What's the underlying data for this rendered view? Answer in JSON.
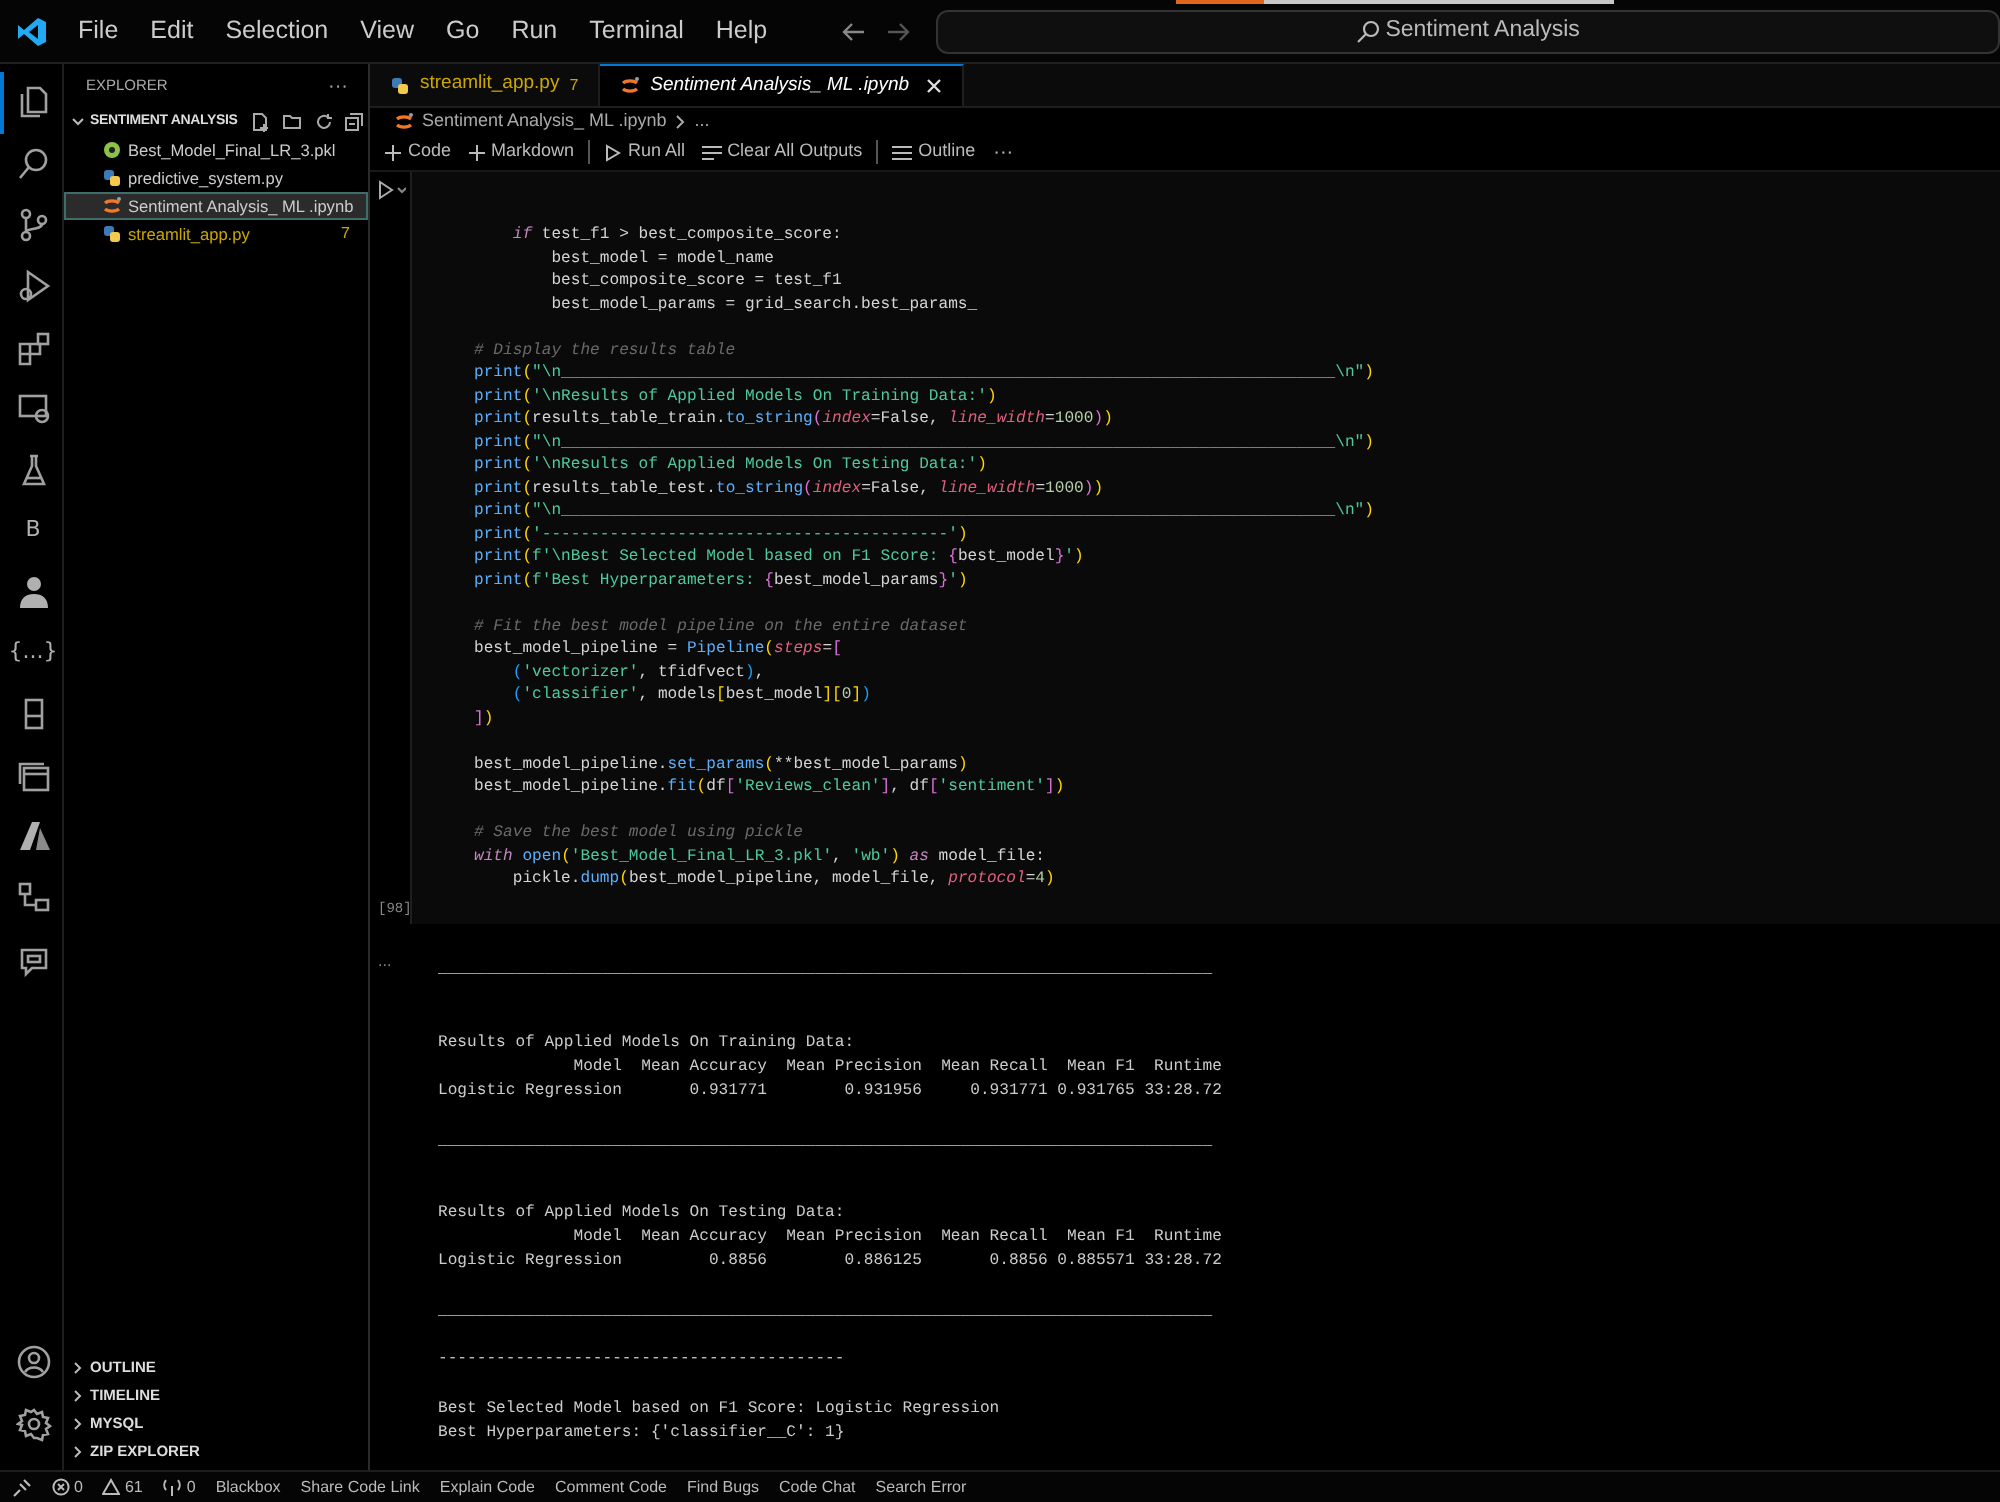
{
  "title_bar": {
    "menu": [
      "File",
      "Edit",
      "Selection",
      "View",
      "Go",
      "Run",
      "Terminal",
      "Help"
    ],
    "search": "Sentiment Analysis",
    "progress": {
      "level": 0.2
    }
  },
  "activity_bar": {
    "top": [
      {
        "kind": "files",
        "selected": true
      },
      {
        "kind": "search",
        "selected": false
      },
      {
        "kind": "source-control",
        "selected": false
      },
      {
        "kind": "run-debug",
        "selected": false
      },
      {
        "kind": "extensions",
        "selected": false
      },
      {
        "kind": "remote",
        "selected": false
      },
      {
        "kind": "flask",
        "selected": false
      },
      {
        "kind": "glyph",
        "text": "B",
        "selected": false
      },
      {
        "kind": "person",
        "selected": false
      },
      {
        "kind": "glyph",
        "text": "{...}",
        "selected": false
      },
      {
        "kind": "book",
        "selected": false
      },
      {
        "kind": "windows",
        "selected": false
      },
      {
        "kind": "azure",
        "selected": false
      },
      {
        "kind": "diagram",
        "selected": false
      },
      {
        "kind": "chat",
        "selected": false
      }
    ],
    "bottom": [
      {
        "kind": "account"
      },
      {
        "kind": "gear"
      }
    ]
  },
  "sidebar": {
    "title": "EXPLORER",
    "more": "···",
    "folder": {
      "label": "SENTIMENT ANALYSIS",
      "expanded": true
    },
    "files": [
      {
        "name": "Best_Model_Final_LR_3.pkl",
        "kind": "pkl",
        "selected": false,
        "warning": false
      },
      {
        "name": "predictive_system.py",
        "kind": "python",
        "selected": false,
        "warning": false
      },
      {
        "name": "Sentiment Analysis_ ML .ipynb",
        "kind": "notebook",
        "selected": true,
        "warning": false
      },
      {
        "name": "streamlit_app.py",
        "kind": "python",
        "selected": false,
        "warning": true,
        "badge": "7"
      }
    ],
    "sections": [
      {
        "label": "OUTLINE",
        "expanded": false
      },
      {
        "label": "TIMELINE",
        "expanded": false
      },
      {
        "label": "MYSQL",
        "expanded": false
      },
      {
        "label": "ZIP EXPLORER",
        "expanded": false
      }
    ]
  },
  "tabs": [
    {
      "label": "streamlit_app.py",
      "kind": "python",
      "badge": "7",
      "selected": false
    },
    {
      "label": "Sentiment Analysis_ ML .ipynb",
      "kind": "notebook",
      "selected": true
    }
  ],
  "breadcrumb": [
    "Sentiment Analysis_ ML .ipynb",
    "..."
  ],
  "toolbar": {
    "items": [
      {
        "kind": "plus",
        "label": "Code"
      },
      {
        "kind": "plus",
        "label": "Markdown"
      },
      {
        "kind": "separator"
      },
      {
        "kind": "run",
        "label": "Run All"
      },
      {
        "kind": "clear",
        "label": "Clear All Outputs"
      },
      {
        "kind": "separator"
      },
      {
        "kind": "list",
        "label": "Outline"
      }
    ],
    "more": "···"
  },
  "cell": {
    "execution_count": "[98]",
    "lines": [
      {
        "kind": "code",
        "tokens": [
          {
            "kind": "kw",
            "text": "    if"
          },
          {
            "kind": "plain",
            "text": " test_f1 > best_composite_score:"
          }
        ]
      },
      {
        "kind": "code",
        "tokens": [
          {
            "kind": "plain",
            "text": "        best_model = model_name"
          }
        ]
      },
      {
        "kind": "code",
        "tokens": [
          {
            "kind": "plain",
            "text": "        best_composite_score = test_f1"
          }
        ]
      },
      {
        "kind": "code",
        "tokens": [
          {
            "kind": "plain",
            "text": "        best_model_params = grid_search.best_params_"
          }
        ]
      },
      {
        "kind": "blank"
      },
      {
        "kind": "code",
        "tokens": [
          {
            "kind": "cmt",
            "text": "# Display the results table"
          }
        ]
      },
      {
        "kind": "code",
        "tokens": [
          {
            "kind": "fn",
            "text": "print"
          },
          {
            "kind": "br1",
            "text": "("
          },
          {
            "kind": "str",
            "text": "\"\\n________________________________________________________________________________\\n\""
          },
          {
            "kind": "br1",
            "text": ")"
          }
        ]
      },
      {
        "kind": "code",
        "tokens": [
          {
            "kind": "fn",
            "text": "print"
          },
          {
            "kind": "br1",
            "text": "("
          },
          {
            "kind": "str",
            "text": "'\\nResults of Applied Models On Training Data:'"
          },
          {
            "kind": "br1",
            "text": ")"
          }
        ]
      },
      {
        "kind": "code",
        "tokens": [
          {
            "kind": "fn",
            "text": "print"
          },
          {
            "kind": "br1",
            "text": "("
          },
          {
            "kind": "plain",
            "text": "results_table_train."
          },
          {
            "kind": "fn",
            "text": "to_string"
          },
          {
            "kind": "br2",
            "text": "("
          },
          {
            "kind": "param",
            "text": "index"
          },
          {
            "kind": "plain",
            "text": "=False, "
          },
          {
            "kind": "param",
            "text": "line_width"
          },
          {
            "kind": "plain",
            "text": "="
          },
          {
            "kind": "num",
            "text": "1000"
          },
          {
            "kind": "br2",
            "text": ")"
          },
          {
            "kind": "br1",
            "text": ")"
          }
        ]
      },
      {
        "kind": "code",
        "tokens": [
          {
            "kind": "fn",
            "text": "print"
          },
          {
            "kind": "br1",
            "text": "("
          },
          {
            "kind": "str",
            "text": "\"\\n________________________________________________________________________________\\n\""
          },
          {
            "kind": "br1",
            "text": ")"
          }
        ]
      },
      {
        "kind": "code",
        "tokens": [
          {
            "kind": "fn",
            "text": "print"
          },
          {
            "kind": "br1",
            "text": "("
          },
          {
            "kind": "str",
            "text": "'\\nResults of Applied Models On Testing Data:'"
          },
          {
            "kind": "br1",
            "text": ")"
          }
        ]
      },
      {
        "kind": "code",
        "tokens": [
          {
            "kind": "fn",
            "text": "print"
          },
          {
            "kind": "br1",
            "text": "("
          },
          {
            "kind": "plain",
            "text": "results_table_test."
          },
          {
            "kind": "fn",
            "text": "to_string"
          },
          {
            "kind": "br2",
            "text": "("
          },
          {
            "kind": "param",
            "text": "index"
          },
          {
            "kind": "plain",
            "text": "=False, "
          },
          {
            "kind": "param",
            "text": "line_width"
          },
          {
            "kind": "plain",
            "text": "="
          },
          {
            "kind": "num",
            "text": "1000"
          },
          {
            "kind": "br2",
            "text": ")"
          },
          {
            "kind": "br1",
            "text": ")"
          }
        ]
      },
      {
        "kind": "code",
        "tokens": [
          {
            "kind": "fn",
            "text": "print"
          },
          {
            "kind": "br1",
            "text": "("
          },
          {
            "kind": "str",
            "text": "\"\\n________________________________________________________________________________\\n\""
          },
          {
            "kind": "br1",
            "text": ")"
          }
        ]
      },
      {
        "kind": "code",
        "tokens": [
          {
            "kind": "fn",
            "text": "print"
          },
          {
            "kind": "br1",
            "text": "("
          },
          {
            "kind": "str",
            "text": "'------------------------------------------'"
          },
          {
            "kind": "br1",
            "text": ")"
          }
        ]
      },
      {
        "kind": "code",
        "tokens": [
          {
            "kind": "fn",
            "text": "print"
          },
          {
            "kind": "br1",
            "text": "("
          },
          {
            "kind": "str",
            "text": "f'\\nBest Selected Model based on F1 Score: "
          },
          {
            "kind": "br2",
            "text": "{"
          },
          {
            "kind": "plain",
            "text": "best_model"
          },
          {
            "kind": "br2",
            "text": "}"
          },
          {
            "kind": "str",
            "text": "'"
          },
          {
            "kind": "br1",
            "text": ")"
          }
        ]
      },
      {
        "kind": "code",
        "tokens": [
          {
            "kind": "fn",
            "text": "print"
          },
          {
            "kind": "br1",
            "text": "("
          },
          {
            "kind": "str",
            "text": "f'Best Hyperparameters: "
          },
          {
            "kind": "br2",
            "text": "{"
          },
          {
            "kind": "plain",
            "text": "best_model_params"
          },
          {
            "kind": "br2",
            "text": "}"
          },
          {
            "kind": "str",
            "text": "'"
          },
          {
            "kind": "br1",
            "text": ")"
          }
        ]
      },
      {
        "kind": "blank"
      },
      {
        "kind": "code",
        "tokens": [
          {
            "kind": "cmt",
            "text": "# Fit the best model pipeline on the entire dataset"
          }
        ]
      },
      {
        "kind": "code",
        "tokens": [
          {
            "kind": "plain",
            "text": "best_model_pipeline = "
          },
          {
            "kind": "fn",
            "text": "Pipeline"
          },
          {
            "kind": "br1",
            "text": "("
          },
          {
            "kind": "param",
            "text": "steps"
          },
          {
            "kind": "plain",
            "text": "="
          },
          {
            "kind": "br2",
            "text": "["
          }
        ]
      },
      {
        "kind": "code",
        "tokens": [
          {
            "kind": "br3",
            "text": "    ("
          },
          {
            "kind": "str",
            "text": "'vectorizer'"
          },
          {
            "kind": "plain",
            "text": ", tfidfvect"
          },
          {
            "kind": "br3",
            "text": ")"
          },
          {
            "kind": "plain",
            "text": ","
          }
        ]
      },
      {
        "kind": "code",
        "tokens": [
          {
            "kind": "br3",
            "text": "    ("
          },
          {
            "kind": "str",
            "text": "'classifier'"
          },
          {
            "kind": "plain",
            "text": ", models"
          },
          {
            "kind": "br1",
            "text": "["
          },
          {
            "kind": "plain",
            "text": "best_model"
          },
          {
            "kind": "br1",
            "text": "]["
          },
          {
            "kind": "num",
            "text": "0"
          },
          {
            "kind": "br1",
            "text": "]"
          },
          {
            "kind": "br3",
            "text": ")"
          }
        ]
      },
      {
        "kind": "code",
        "tokens": [
          {
            "kind": "br2",
            "text": "]"
          },
          {
            "kind": "br1",
            "text": ")"
          }
        ]
      },
      {
        "kind": "blank"
      },
      {
        "kind": "code",
        "tokens": [
          {
            "kind": "plain",
            "text": "best_model_pipeline."
          },
          {
            "kind": "fn",
            "text": "set_params"
          },
          {
            "kind": "br1",
            "text": "("
          },
          {
            "kind": "plain",
            "text": "**best_model_params"
          },
          {
            "kind": "br1",
            "text": ")"
          }
        ]
      },
      {
        "kind": "code",
        "tokens": [
          {
            "kind": "plain",
            "text": "best_model_pipeline."
          },
          {
            "kind": "fn",
            "text": "fit"
          },
          {
            "kind": "br1",
            "text": "("
          },
          {
            "kind": "plain",
            "text": "df"
          },
          {
            "kind": "br2",
            "text": "["
          },
          {
            "kind": "str",
            "text": "'Reviews_clean'"
          },
          {
            "kind": "br2",
            "text": "]"
          },
          {
            "kind": "plain",
            "text": ", df"
          },
          {
            "kind": "br2",
            "text": "["
          },
          {
            "kind": "str",
            "text": "'sentiment'"
          },
          {
            "kind": "br2",
            "text": "]"
          },
          {
            "kind": "br1",
            "text": ")"
          }
        ]
      },
      {
        "kind": "blank"
      },
      {
        "kind": "code",
        "tokens": [
          {
            "kind": "cmt",
            "text": "# Save the best model using pickle"
          }
        ]
      },
      {
        "kind": "code",
        "tokens": [
          {
            "kind": "kw",
            "text": "with "
          },
          {
            "kind": "fn",
            "text": "open"
          },
          {
            "kind": "br1",
            "text": "("
          },
          {
            "kind": "str",
            "text": "'Best_Model_Final_LR_3.pkl'"
          },
          {
            "kind": "plain",
            "text": ", "
          },
          {
            "kind": "str",
            "text": "'wb'"
          },
          {
            "kind": "br1",
            "text": ")"
          },
          {
            "kind": "kw",
            "text": " as"
          },
          {
            "kind": "plain",
            "text": " model_file:"
          }
        ]
      },
      {
        "kind": "code",
        "tokens": [
          {
            "kind": "plain",
            "text": "    pickle."
          },
          {
            "kind": "fn",
            "text": "dump"
          },
          {
            "kind": "br1",
            "text": "("
          },
          {
            "kind": "plain",
            "text": "best_model_pipeline, model_file, "
          },
          {
            "kind": "param",
            "text": "protocol"
          },
          {
            "kind": "plain",
            "text": "="
          },
          {
            "kind": "num",
            "text": "4"
          },
          {
            "kind": "br1",
            "text": ")"
          }
        ]
      }
    ]
  },
  "output": {
    "more": "...",
    "lines": [
      {
        "kind": "blank"
      },
      {
        "kind": "text",
        "text": "________________________________________________________________________________"
      },
      {
        "kind": "blank"
      },
      {
        "kind": "blank"
      },
      {
        "kind": "text",
        "text": "Results of Applied Models On Training Data:"
      },
      {
        "kind": "text",
        "text": "              Model  Mean Accuracy  Mean Precision  Mean Recall  Mean F1  Runtime"
      },
      {
        "kind": "text",
        "text": "Logistic Regression       0.931771        0.931956     0.931771 0.931765 33:28.72"
      },
      {
        "kind": "blank"
      },
      {
        "kind": "text",
        "text": "________________________________________________________________________________"
      },
      {
        "kind": "blank"
      },
      {
        "kind": "blank"
      },
      {
        "kind": "text",
        "text": "Results of Applied Models On Testing Data:"
      },
      {
        "kind": "text",
        "text": "              Model  Mean Accuracy  Mean Precision  Mean Recall  Mean F1  Runtime"
      },
      {
        "kind": "text",
        "text": "Logistic Regression         0.8856        0.886125       0.8856 0.885571 33:28.72"
      },
      {
        "kind": "blank"
      },
      {
        "kind": "text",
        "text": "________________________________________________________________________________"
      },
      {
        "kind": "blank"
      },
      {
        "kind": "text",
        "text": "------------------------------------------"
      },
      {
        "kind": "blank"
      },
      {
        "kind": "text",
        "text": "Best Selected Model based on F1 Score: Logistic Regression"
      },
      {
        "kind": "text",
        "text": "Best Hyperparameters: {'classifier__C': 1}"
      }
    ]
  },
  "status_bar": [
    {
      "kind": "remote"
    },
    {
      "kind": "errors",
      "text": "0"
    },
    {
      "kind": "warnings",
      "text": "61"
    },
    {
      "kind": "ports",
      "text": "0"
    },
    {
      "kind": "label",
      "text": "Blackbox"
    },
    {
      "kind": "label",
      "text": "Share Code Link"
    },
    {
      "kind": "label",
      "text": "Explain Code"
    },
    {
      "kind": "label",
      "text": "Comment Code"
    },
    {
      "kind": "label",
      "text": "Find Bugs"
    },
    {
      "kind": "label",
      "text": "Code Chat"
    },
    {
      "kind": "label",
      "text": "Search Error"
    }
  ]
}
